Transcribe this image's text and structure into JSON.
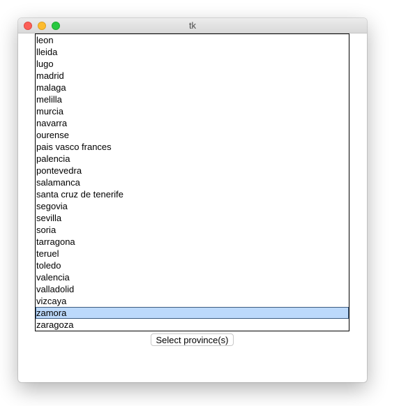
{
  "window": {
    "title": "tk"
  },
  "listbox": {
    "items": [
      "leon",
      "lleida",
      "lugo",
      "madrid",
      "malaga",
      "melilla",
      "murcia",
      "navarra",
      "ourense",
      "pais vasco frances",
      "palencia",
      "pontevedra",
      "salamanca",
      "santa cruz de tenerife",
      "segovia",
      "sevilla",
      "soria",
      "tarragona",
      "teruel",
      "toledo",
      "valencia",
      "valladolid",
      "vizcaya",
      "zamora",
      "zaragoza"
    ],
    "selected_index": 23,
    "selection_color": "#bcd9fb"
  },
  "button": {
    "label": "Select province(s)"
  }
}
